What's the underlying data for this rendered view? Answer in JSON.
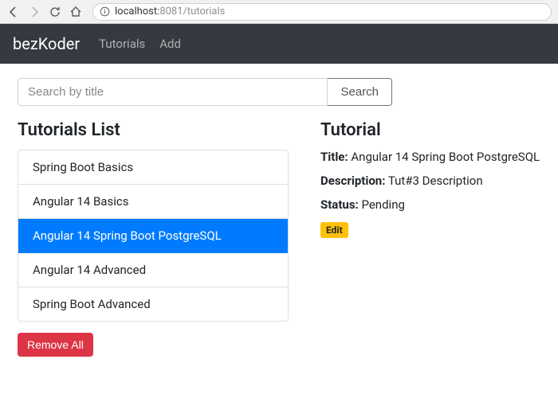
{
  "browser": {
    "url_host": "localhost:",
    "url_port": "8081",
    "url_path": "/tutorials"
  },
  "navbar": {
    "brand": "bezKoder",
    "links": [
      "Tutorials",
      "Add"
    ]
  },
  "search": {
    "placeholder": "Search by title",
    "button": "Search"
  },
  "list": {
    "heading": "Tutorials List",
    "items": [
      "Spring Boot Basics",
      "Angular 14 Basics",
      "Angular 14 Spring Boot PostgreSQL",
      "Angular 14 Advanced",
      "Spring Boot Advanced"
    ],
    "active_index": 2,
    "remove_all": "Remove All"
  },
  "detail": {
    "heading": "Tutorial",
    "title_label": "Title:",
    "title_value": "Angular 14 Spring Boot PostgreSQL",
    "description_label": "Description:",
    "description_value": "Tut#3 Description",
    "status_label": "Status:",
    "status_value": "Pending",
    "edit": "Edit"
  }
}
